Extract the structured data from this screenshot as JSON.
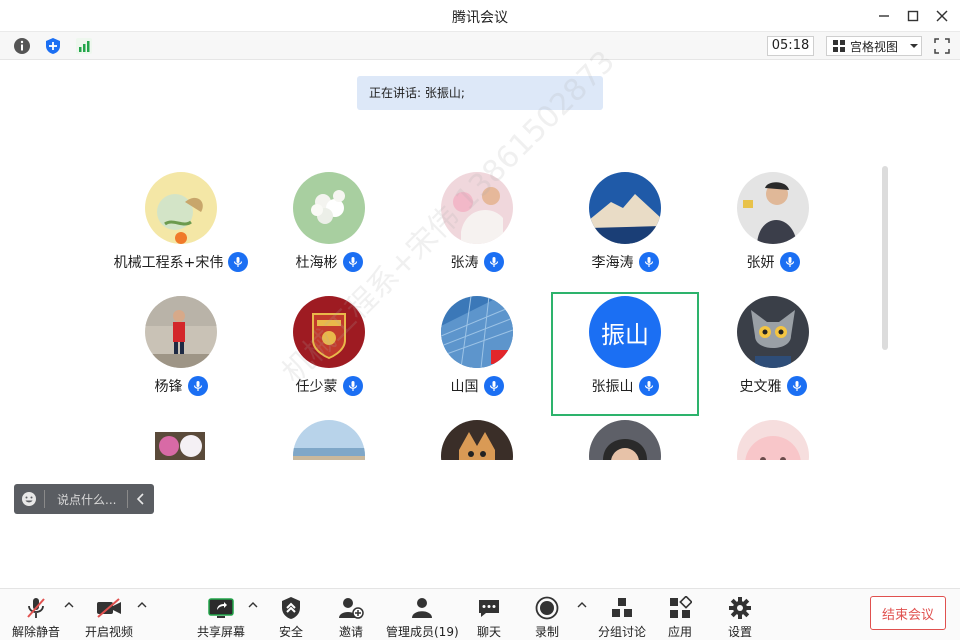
{
  "window": {
    "title": "腾讯会议"
  },
  "toolbar": {
    "timer": "05:18",
    "view_mode": "宫格视图"
  },
  "speaking": {
    "label": "正在讲话:",
    "name": "张振山;"
  },
  "participants": [
    {
      "name": "机械工程系+宋伟",
      "avatar": "photo"
    },
    {
      "name": "杜海彬",
      "avatar": "photo"
    },
    {
      "name": "张涛",
      "avatar": "photo"
    },
    {
      "name": "李海涛",
      "avatar": "photo"
    },
    {
      "name": "张妍",
      "avatar": "photo"
    },
    {
      "name": "杨锋",
      "avatar": "photo"
    },
    {
      "name": "任少蒙",
      "avatar": "photo"
    },
    {
      "name": "山国",
      "avatar": "photo"
    },
    {
      "name": "张振山",
      "avatar_text": "振山",
      "active": true
    },
    {
      "name": "史文雅",
      "avatar": "photo"
    }
  ],
  "watermark": "机械工程系+宋伟 13861502873",
  "chat": {
    "placeholder": "说点什么..."
  },
  "bottom": {
    "unmute": "解除静音",
    "video": "开启视频",
    "share": "共享屏幕",
    "security": "安全",
    "invite": "邀请",
    "members": "管理成员(19)",
    "chat": "聊天",
    "record": "录制",
    "breakout": "分组讨论",
    "apps": "应用",
    "settings": "设置",
    "end": "结束会议"
  },
  "colors": {
    "accent": "#1b6ff3",
    "active_border": "#2db36c",
    "end": "#e0514f"
  }
}
